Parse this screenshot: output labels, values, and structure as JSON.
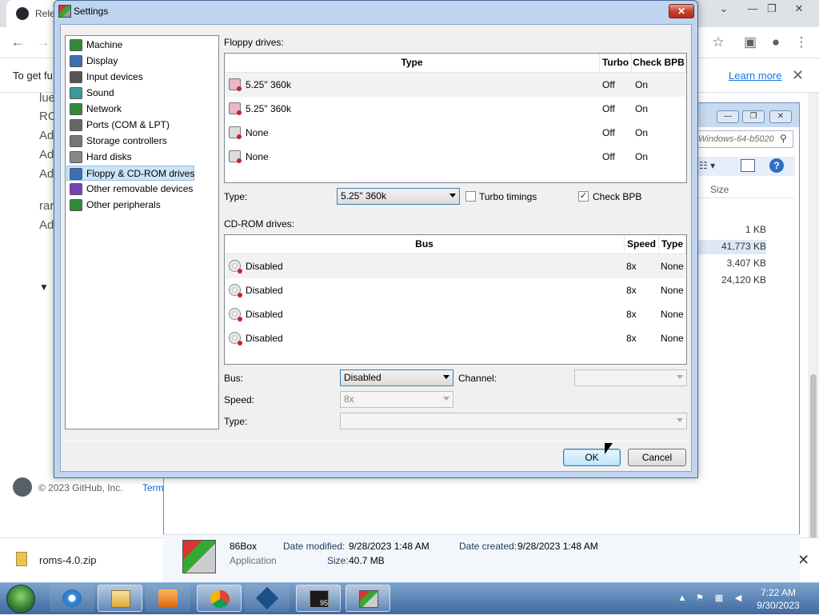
{
  "browser": {
    "tab_title": "Rele",
    "window_controls": {
      "chevron": "⌄",
      "minimize": "—",
      "maximize": "❐",
      "close": "✕"
    },
    "infobar": {
      "text": "To get fu",
      "learn_more": "Learn more",
      "close": "✕"
    },
    "page_lines": [
      "lue",
      "RO",
      "Ad",
      "Ad",
      "Ad",
      "rar",
      "Ad"
    ],
    "footer": {
      "copyright": "© 2023 GitHub, Inc.",
      "terms": "Term"
    },
    "download": {
      "filename": "roms-4.0.zip",
      "close": "✕"
    }
  },
  "explorer": {
    "address": "Windows-64-b5020",
    "column_size": "Size",
    "sizes": [
      "1 KB",
      "41,773 KB",
      "3,407 KB",
      "24,120 KB"
    ],
    "details": {
      "name": "86Box",
      "type": "Application",
      "date_modified_label": "Date modified:",
      "date_modified": "9/28/2023 1:48 AM",
      "date_created_label": "Date created:",
      "date_created": "9/28/2023 1:48 AM",
      "size_label": "Size:",
      "size": "40.7 MB"
    }
  },
  "dialog": {
    "title": "Settings",
    "tree": [
      {
        "label": "Machine",
        "icon": "motherboard-icon",
        "color": "#2e8b3a"
      },
      {
        "label": "Display",
        "icon": "display-icon",
        "color": "#3a70b8"
      },
      {
        "label": "Input devices",
        "icon": "keyboard-icon",
        "color": "#555555"
      },
      {
        "label": "Sound",
        "icon": "speaker-icon",
        "color": "#3a9a9a"
      },
      {
        "label": "Network",
        "icon": "network-icon",
        "color": "#2e8b3a"
      },
      {
        "label": "Ports (COM & LPT)",
        "icon": "ports-icon",
        "color": "#666666"
      },
      {
        "label": "Storage controllers",
        "icon": "storage-icon",
        "color": "#777777"
      },
      {
        "label": "Hard disks",
        "icon": "hard-disk-icon",
        "color": "#888888"
      },
      {
        "label": "Floppy & CD-ROM drives",
        "icon": "floppy-cdrom-icon",
        "color": "#3a70b8",
        "selected": true
      },
      {
        "label": "Other removable devices",
        "icon": "removable-icon",
        "color": "#7b3fb8"
      },
      {
        "label": "Other peripherals",
        "icon": "peripherals-icon",
        "color": "#2e8b3a"
      }
    ],
    "floppy": {
      "label": "Floppy drives:",
      "columns": [
        "Type",
        "Turbo",
        "Check BPB"
      ],
      "rows": [
        {
          "type": "5.25\" 360k",
          "turbo": "Off",
          "check_bpb": "On",
          "icon": "floppy-icon"
        },
        {
          "type": "5.25\" 360k",
          "turbo": "Off",
          "check_bpb": "On",
          "icon": "floppy-icon"
        },
        {
          "type": "None",
          "turbo": "Off",
          "check_bpb": "On",
          "icon": "floppy-disabled-icon"
        },
        {
          "type": "None",
          "turbo": "Off",
          "check_bpb": "On",
          "icon": "floppy-disabled-icon"
        }
      ],
      "type_label": "Type:",
      "type_value": "5.25\" 360k",
      "turbo_label": "Turbo timings",
      "turbo_checked": false,
      "check_bpb_label": "Check BPB",
      "check_bpb_checked": true
    },
    "cdrom": {
      "label": "CD-ROM drives:",
      "columns": [
        "Bus",
        "Speed",
        "Type"
      ],
      "rows": [
        {
          "bus": "Disabled",
          "speed": "8x",
          "type": "None"
        },
        {
          "bus": "Disabled",
          "speed": "8x",
          "type": "None"
        },
        {
          "bus": "Disabled",
          "speed": "8x",
          "type": "None"
        },
        {
          "bus": "Disabled",
          "speed": "8x",
          "type": "None"
        }
      ],
      "bus_label": "Bus:",
      "bus_value": "Disabled",
      "channel_label": "Channel:",
      "channel_value": "",
      "speed_label": "Speed:",
      "speed_value": "8x",
      "type_label": "Type:",
      "type_value": ""
    },
    "ok": "OK",
    "cancel": "Cancel"
  },
  "taskbar": {
    "apps": [
      "internet-explorer-icon",
      "folder-icon",
      "media-player-icon",
      "chrome-icon",
      "virtualbox-icon",
      "win95-vm-icon",
      "86box-icon"
    ],
    "time": "7:22 AM",
    "date": "9/30/2023"
  }
}
